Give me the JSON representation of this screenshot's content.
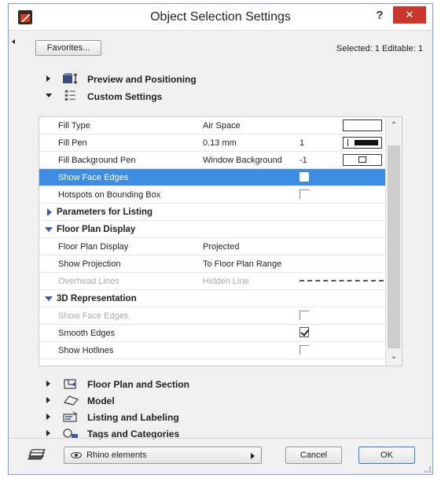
{
  "window": {
    "title": "Object Selection Settings",
    "help_label": "?",
    "close_label": "✕"
  },
  "toolbar": {
    "favorites_label": "Favorites...",
    "selected_info": "Selected: 1 Editable: 1"
  },
  "sections": {
    "preview": "Preview and Positioning",
    "custom": "Custom Settings",
    "floor_plan_section": "Floor Plan and Section",
    "model": "Model",
    "listing": "Listing and Labeling",
    "tags": "Tags and Categories"
  },
  "params": {
    "fill_type": {
      "name": "Fill Type",
      "value": "Air Space"
    },
    "fill_pen": {
      "name": "Fill Pen",
      "value": "0.13 mm",
      "extra": "1"
    },
    "fill_bg_pen": {
      "name": "Fill Background Pen",
      "value": "Window Background",
      "extra": "-1"
    },
    "show_face_edges": {
      "name": "Show Face Edges"
    },
    "hotspots": {
      "name": "Hotspots on Bounding Box"
    },
    "group_listing": "Parameters for Listing",
    "group_floor_plan": "Floor Plan Display",
    "fp_display": {
      "name": "Floor Plan Display",
      "value": "Projected"
    },
    "show_projection": {
      "name": "Show Projection",
      "value": "To Floor Plan Range"
    },
    "overhead_lines": {
      "name": "Overhead Lines",
      "value": "Hidden Line"
    },
    "group_3d": "3D Representation",
    "show_face_edges_3d": {
      "name": "Show Face Edges"
    },
    "smooth_edges": {
      "name": "Smooth Edges",
      "checked": true
    },
    "show_hotlines": {
      "name": "Show Hotlines"
    }
  },
  "footer": {
    "layer_label": "Rhino elements",
    "cancel_label": "Cancel",
    "ok_label": "OK"
  }
}
